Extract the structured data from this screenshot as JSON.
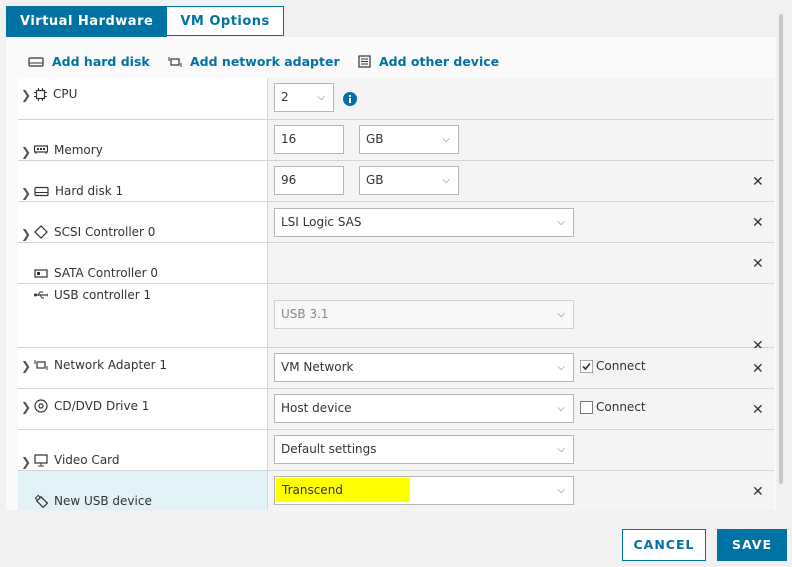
{
  "tabs": [
    {
      "label": "Virtual Hardware",
      "active": true
    },
    {
      "label": "VM Options",
      "active": false
    }
  ],
  "add_bar": {
    "hard_disk": "Add hard disk",
    "network_adapter": "Add network adapter",
    "other_device": "Add other device"
  },
  "rows": {
    "cpu": {
      "label": "CPU",
      "value": "2"
    },
    "memory": {
      "label": "Memory",
      "value": "16",
      "unit": "GB"
    },
    "hard_disk": {
      "label": "Hard disk 1",
      "value": "96",
      "unit": "GB"
    },
    "scsi": {
      "label": "SCSI Controller 0",
      "value": "LSI Logic SAS"
    },
    "sata": {
      "label": "SATA Controller 0"
    },
    "usb": {
      "label": "USB controller 1",
      "value": "USB 3.1"
    },
    "network": {
      "label": "Network Adapter 1",
      "value": "VM Network",
      "connect_label": "Connect",
      "connected": true
    },
    "cddvd": {
      "label": "CD/DVD Drive 1",
      "value": "Host device",
      "connect_label": "Connect",
      "connected": false
    },
    "video": {
      "label": "Video Card",
      "value": "Default settings"
    },
    "new_usb": {
      "label": "New USB device",
      "value": "Transcend"
    }
  },
  "footer": {
    "cancel": "CANCEL",
    "save": "SAVE"
  },
  "colors": {
    "accent": "#0072a3",
    "highlight": "#ffff00",
    "selected_row": "#e1f1f8"
  }
}
